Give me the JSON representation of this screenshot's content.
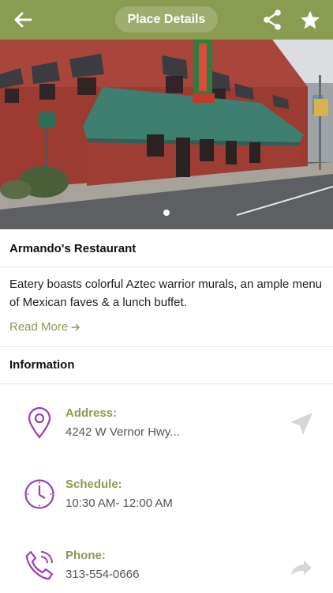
{
  "header": {
    "title": "Place Details",
    "back_icon": "back-arrow-icon",
    "share_icon": "share-icon",
    "favorite_icon": "star-icon"
  },
  "place": {
    "name": "Armando's Restaurant",
    "description": "Eatery boasts colorful Aztec warrior murals, an ample menu of Mexican faves & a lunch buffet.",
    "read_more": "Read More"
  },
  "carousel": {
    "current_index": 1,
    "count": 1
  },
  "information": {
    "title": "Information",
    "address": {
      "label": "Address:",
      "value": "4242 W Vernor Hwy..."
    },
    "schedule": {
      "label": "Schedule:",
      "value": "10:30 AM- 12:00 AM"
    },
    "phone": {
      "label": "Phone:",
      "value": "313-554-0666"
    }
  },
  "colors": {
    "accent": "#8a9b52",
    "icon_purple": "#9b3fb3",
    "action_gray": "#d6d6d6"
  }
}
